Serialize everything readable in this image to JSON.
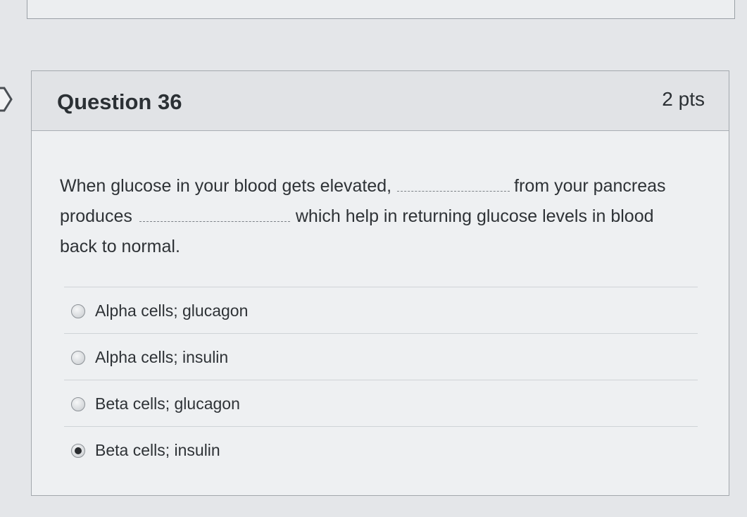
{
  "question": {
    "title": "Question 36",
    "points": "2 pts",
    "text_part1": "When glucose in your blood gets elevated,",
    "text_part2": "from your pancreas produces",
    "text_part3": "which help in returning glucose levels in blood back to normal."
  },
  "answers": [
    {
      "label": "Alpha cells; glucagon",
      "selected": false
    },
    {
      "label": "Alpha cells; insulin",
      "selected": false
    },
    {
      "label": "Beta cells; glucagon",
      "selected": false
    },
    {
      "label": "Beta cells; insulin",
      "selected": true
    }
  ]
}
